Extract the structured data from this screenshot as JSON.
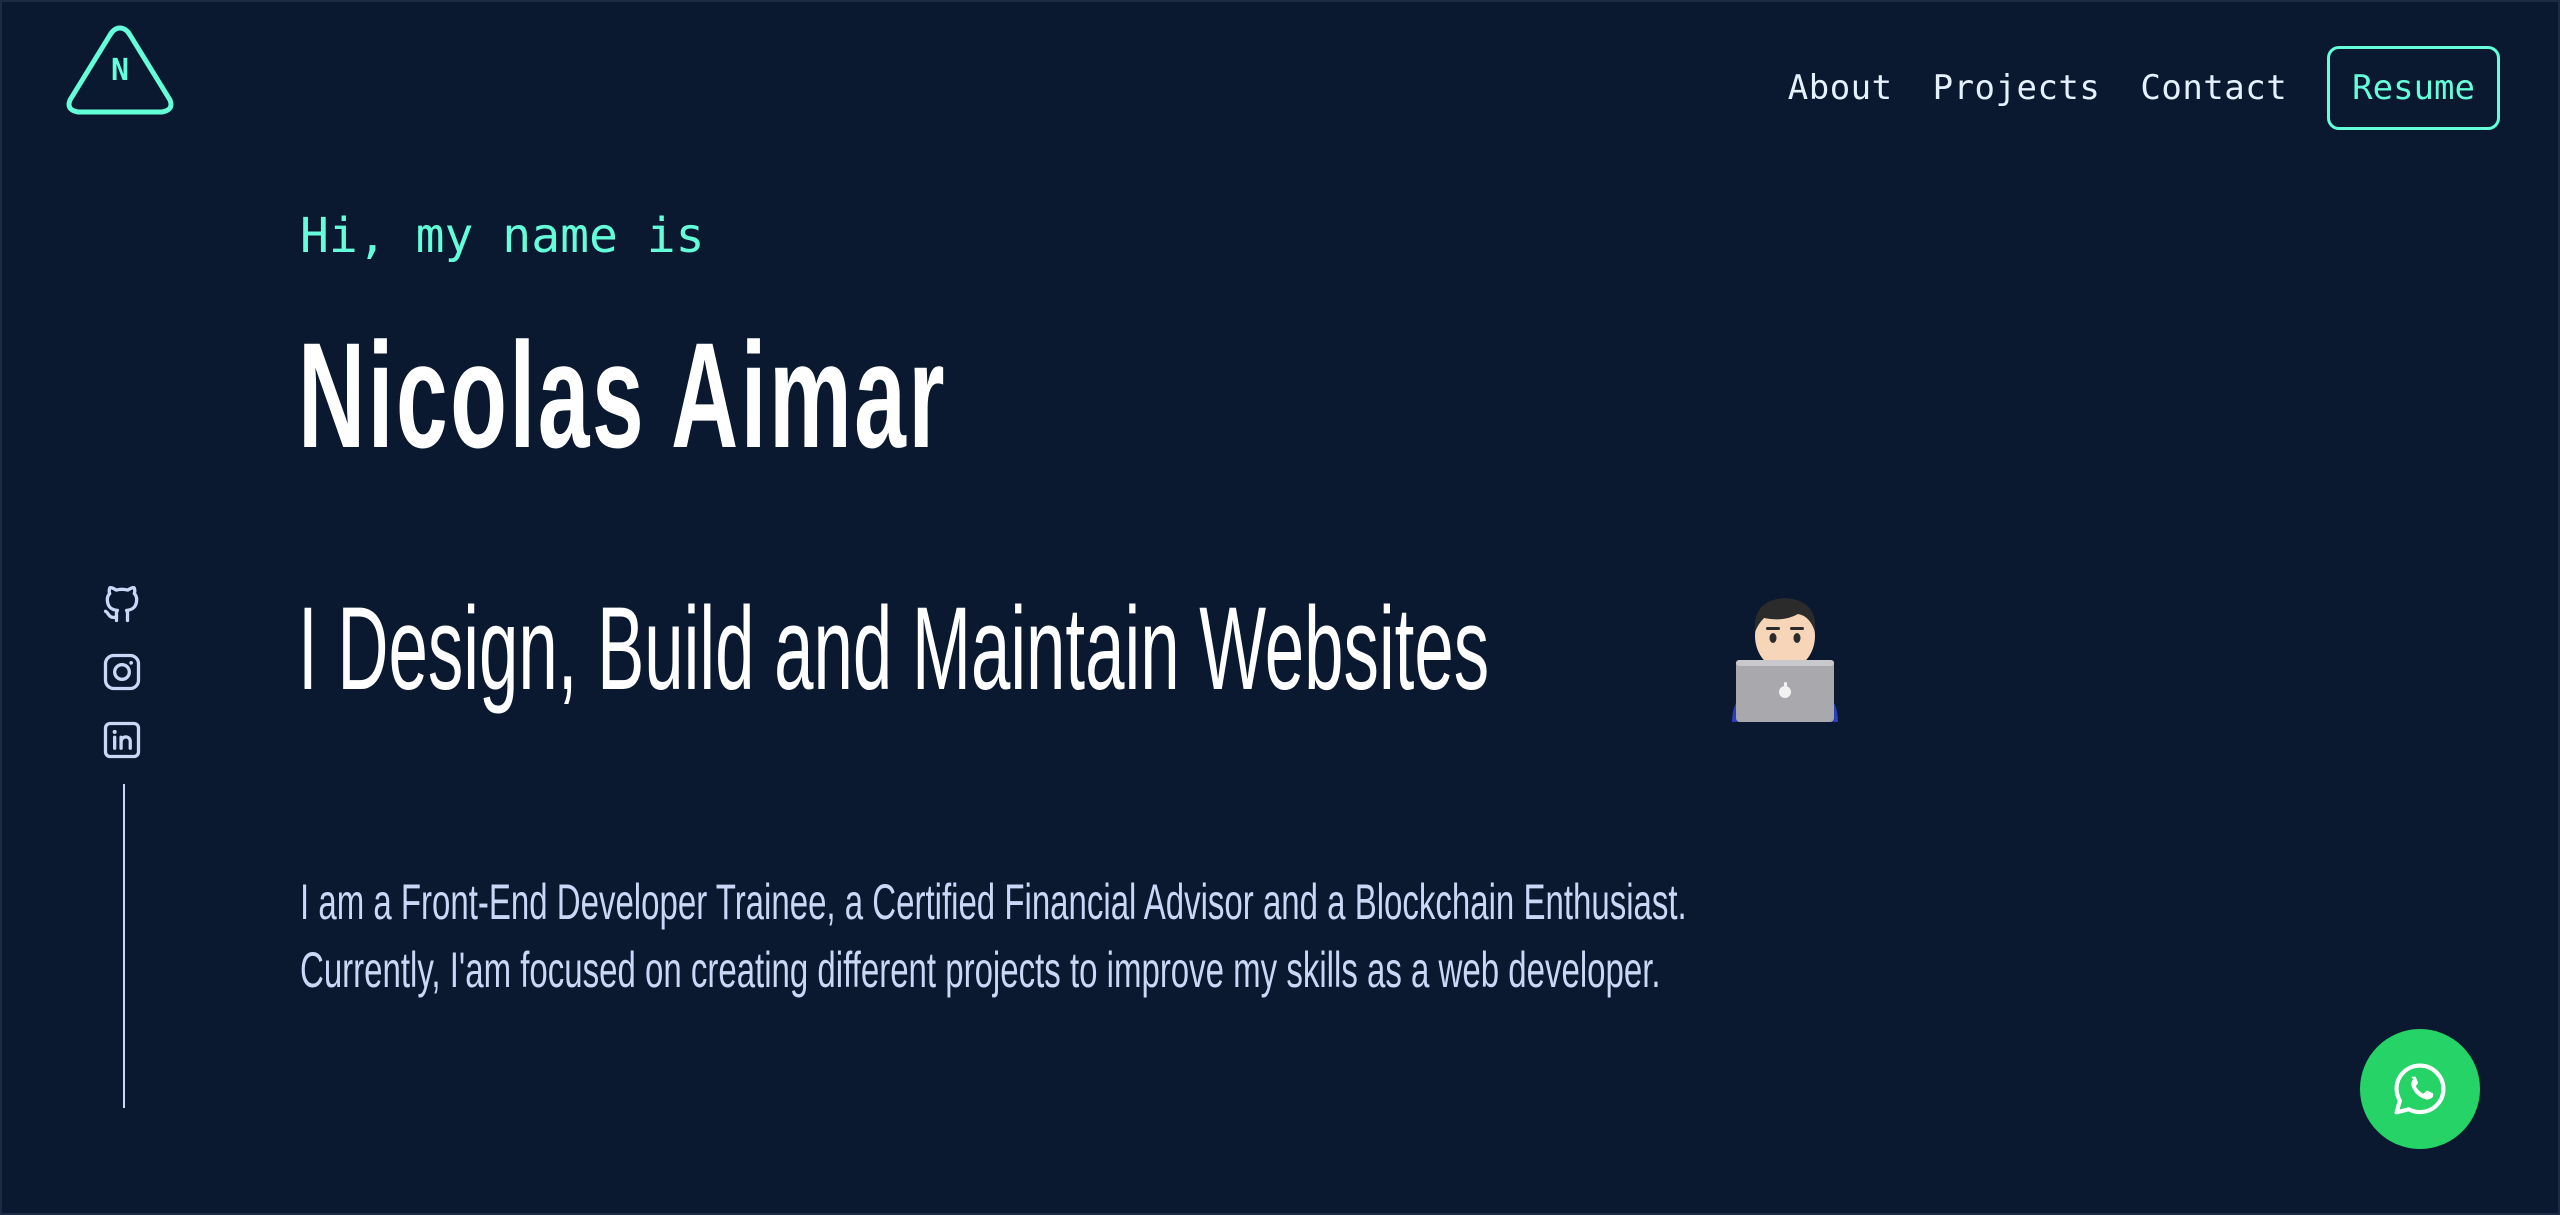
{
  "brand": {
    "logo_letter": "N"
  },
  "nav": {
    "links": [
      {
        "label": "About"
      },
      {
        "label": "Projects"
      },
      {
        "label": "Contact"
      }
    ],
    "resume_label": "Resume"
  },
  "hero": {
    "greeting": "Hi, my name is",
    "name": "Nicolas Aimar",
    "tagline": "I Design, Build and Maintain Websites",
    "tagline_emoji": "technologist-icon",
    "bio_lines": [
      "I am a Front-End Developer Trainee, a Certified Financial Advisor and a Blockchain Enthusiast.",
      "Currently, I'am focused on creating different projects to improve my skills as a web developer."
    ]
  },
  "social": {
    "icons": [
      "github-icon",
      "instagram-icon",
      "linkedin-icon"
    ]
  },
  "colors": {
    "background": "#0a192f",
    "accent": "#64ffda",
    "text": "#ccd6f6",
    "heading": "#ffffff",
    "whatsapp": "#25d366"
  }
}
